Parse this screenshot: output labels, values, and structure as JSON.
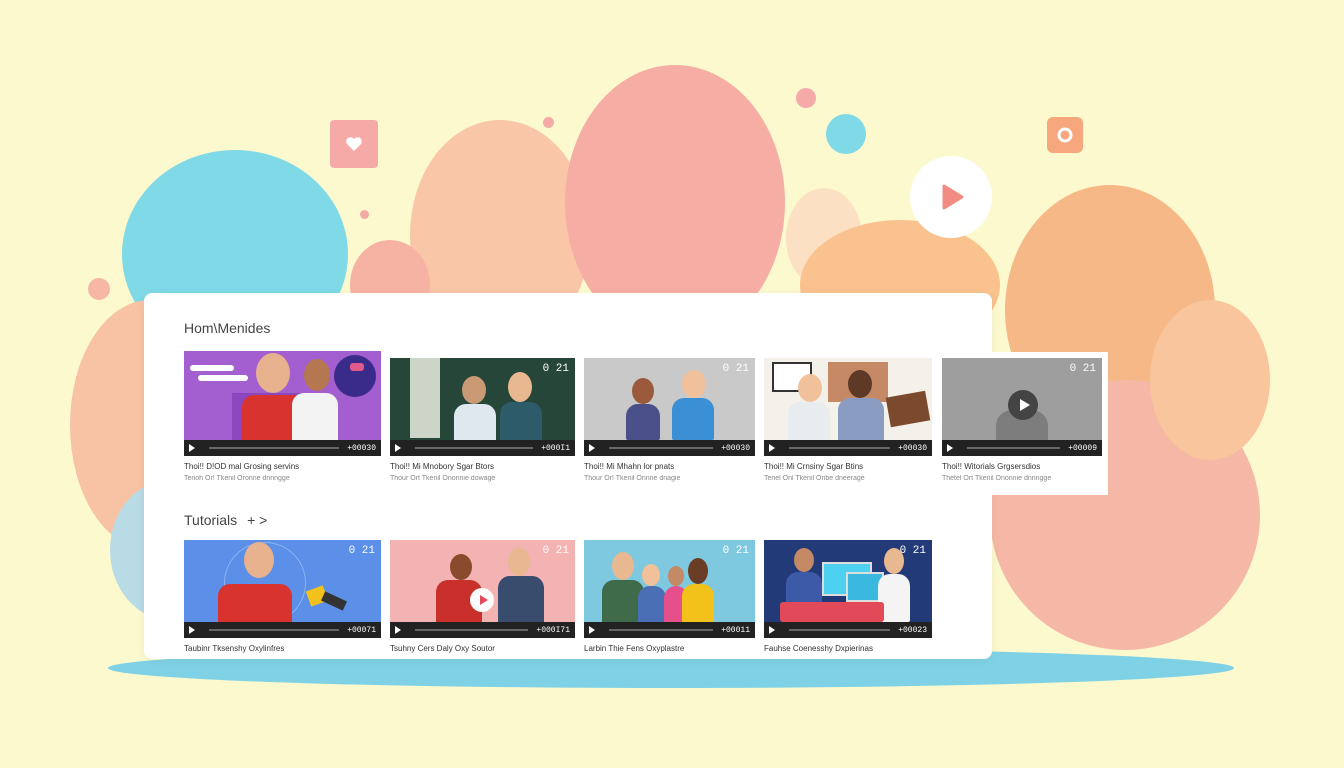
{
  "sections": {
    "home": {
      "title": "Hom\\Menides",
      "videos": [
        {
          "title": "Thoi!! D!OD mal Grosing servins",
          "meta": "Tenoh Or! Tkenil Oronne dnnngge",
          "time": "+00030",
          "badge": ""
        },
        {
          "title": "Thoi!! Mi Mnobory Sgar Btors",
          "meta": "Thour Ort Tkenil Ononnie dowage",
          "time": "+000I1",
          "badge": "0 21"
        },
        {
          "title": "Thoi!! Mi Mhahn lor pnats",
          "meta": "Thour Or! Tkenil Onnne dnagie",
          "time": "+00030",
          "badge": "0 21"
        },
        {
          "title": "Thoi!! Mi Crnsiny Sgar Btins",
          "meta": "Tenel Onl Tkenil Onbe dneerage",
          "time": "+00030",
          "badge": ""
        },
        {
          "title": "Thoi!! Witorials Grgsersdios",
          "meta": "Thetel Ort Tkenil Ononnie dnnngge",
          "time": "+00009",
          "badge": "0 21"
        }
      ]
    },
    "tutorials": {
      "title": "Tutorials",
      "arrow": "+ >",
      "videos": [
        {
          "title": "Taubinr Tksenshy Oxylinfres",
          "time": "+00071",
          "badge": "0 21"
        },
        {
          "title": "Tsuhny Cers Daly Oxy Soutor",
          "time": "+000I71",
          "badge": "0 21"
        },
        {
          "title": "Larbin Thie Fens Oxyplastre",
          "time": "+00011",
          "badge": "0 21"
        },
        {
          "title": "Fauhse Coenesshy Dxpierinas",
          "time": "+00023",
          "badge": "0 21"
        }
      ]
    }
  },
  "icons": {
    "heart": "heart-icon",
    "play": "play-icon",
    "camera": "camera-icon"
  },
  "colors": {
    "background": "#fdf9cf",
    "accent_red": "#e24a5a"
  }
}
